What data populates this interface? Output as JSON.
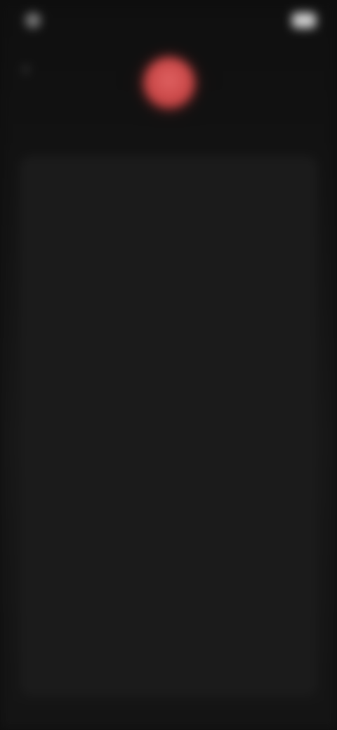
{
  "status_bar": {
    "time": "",
    "right_text": ""
  },
  "header": {
    "title": ""
  },
  "list": {
    "items": [
      {
        "title": "",
        "subtitle": ""
      },
      {
        "title": "",
        "subtitle": ""
      },
      {
        "title": "",
        "subtitle": ""
      },
      {
        "title": "",
        "subtitle": ""
      },
      {
        "title": "",
        "subtitle": ""
      },
      {
        "title": "",
        "subtitle": ""
      },
      {
        "title": "",
        "subtitle": ""
      },
      {
        "title": "",
        "subtitle": ""
      }
    ]
  },
  "colors": {
    "background": "#0e0e0e",
    "panel": "#1b1b1b",
    "accent": "#d45050"
  },
  "icons": {
    "back": "chevron-left-icon",
    "battery": "battery-icon",
    "avatar": "app-avatar-icon"
  }
}
